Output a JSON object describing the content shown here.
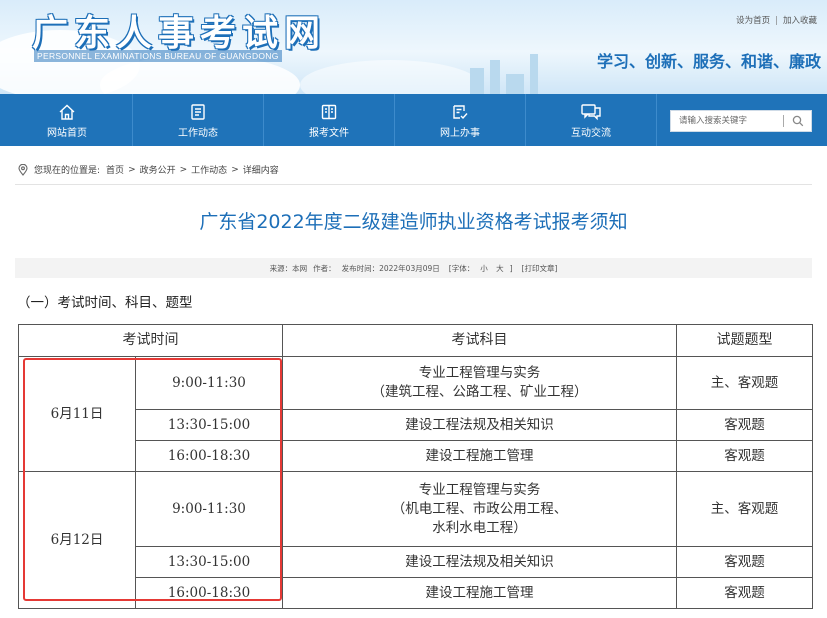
{
  "header": {
    "site_title": "广东人事考试网",
    "site_subtitle": "PERSONNEL EXAMINATIONS BUREAU OF GUANGDONG",
    "top_links": [
      "设为首页",
      "加入收藏"
    ],
    "slogan": "学习、创新、服务、和谐、廉政"
  },
  "nav": {
    "items": [
      {
        "label": "网站首页",
        "icon": "home-icon"
      },
      {
        "label": "工作动态",
        "icon": "news-icon"
      },
      {
        "label": "报考文件",
        "icon": "document-icon"
      },
      {
        "label": "网上办事",
        "icon": "online-service-icon"
      },
      {
        "label": "互动交流",
        "icon": "chat-icon"
      }
    ],
    "search": {
      "placeholder": "请输入搜索关键字",
      "icon": "search-icon"
    }
  },
  "breadcrumb": {
    "prefix": "您现在的位置是:",
    "items": [
      "首页",
      "政务公开",
      "工作动态",
      "详细内容"
    ]
  },
  "article": {
    "title": "广东省2022年度二级建造师执业资格考试报考须知",
    "meta": {
      "source": "来源：本网",
      "author": "作者：",
      "date": "发布时间：2022年03月09日",
      "font_label": "[字体：",
      "font_small": "小",
      "font_big": "大",
      "font_close": "]",
      "print": "[打印文章]"
    },
    "section_heading": "（一）考试时间、科目、题型"
  },
  "exam_table": {
    "headers": [
      "考试时间",
      "考试科目",
      "试题题型"
    ],
    "days": [
      {
        "date": "6月11日",
        "sessions": [
          {
            "time": "9:00-11:30",
            "subject_lines": [
              "专业工程管理与实务",
              "（建筑工程、公路工程、矿业工程）"
            ],
            "type": "主、客观题"
          },
          {
            "time": "13:30-15:00",
            "subject_lines": [
              "建设工程法规及相关知识"
            ],
            "type": "客观题"
          },
          {
            "time": "16:00-18:30",
            "subject_lines": [
              "建设工程施工管理"
            ],
            "type": "客观题"
          }
        ]
      },
      {
        "date": "6月12日",
        "sessions": [
          {
            "time": "9:00-11:30",
            "subject_lines": [
              "专业工程管理与实务",
              "（机电工程、市政公用工程、",
              "水利水电工程）"
            ],
            "type": "主、客观题"
          },
          {
            "time": "13:30-15:00",
            "subject_lines": [
              "建设工程法规及相关知识"
            ],
            "type": "客观题"
          },
          {
            "time": "16:00-18:30",
            "subject_lines": [
              "建设工程施工管理"
            ],
            "type": "客观题"
          }
        ]
      }
    ]
  },
  "colors": {
    "nav_bg": "#1f73b9",
    "title_blue": "#1d6fb8",
    "highlight_red": "#e53935"
  }
}
